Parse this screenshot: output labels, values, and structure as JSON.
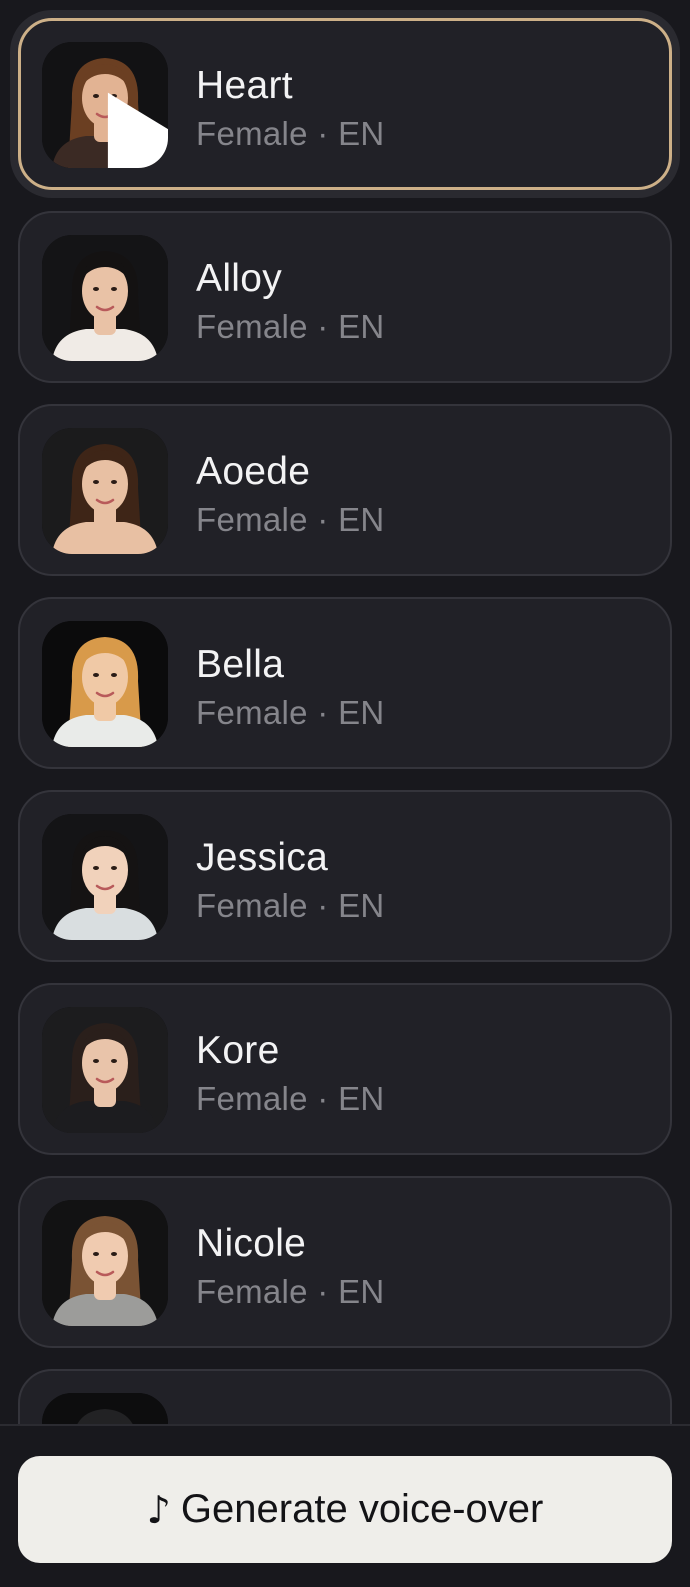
{
  "voices": [
    {
      "name": "Heart",
      "meta": "Female · EN",
      "selected": true,
      "hair": "#6b3f22",
      "skin": "#e2b393",
      "top": "#3b2a24",
      "bg": "#121214"
    },
    {
      "name": "Alloy",
      "meta": "Female · EN",
      "selected": false,
      "hair": "#141212",
      "skin": "#e9c2a6",
      "top": "#f0ebe6",
      "bg": "#141416"
    },
    {
      "name": "Aoede",
      "meta": "Female · EN",
      "selected": false,
      "hair": "#3e2517",
      "skin": "#e8c0a3",
      "top": "#e8c0a3",
      "bg": "#1b1b1c"
    },
    {
      "name": "Bella",
      "meta": "Female · EN",
      "selected": false,
      "hair": "#d89a4a",
      "skin": "#f0c9a6",
      "top": "#e9ebe9",
      "bg": "#0b0b0c"
    },
    {
      "name": "Jessica",
      "meta": "Female · EN",
      "selected": false,
      "hair": "#151313",
      "skin": "#f1d2bb",
      "top": "#d9dee0",
      "bg": "#141416"
    },
    {
      "name": "Kore",
      "meta": "Female · EN",
      "selected": false,
      "hair": "#2a1f1b",
      "skin": "#e9c4aa",
      "top": "#1c1c1f",
      "bg": "#1c1c1e"
    },
    {
      "name": "Nicole",
      "meta": "Female · EN",
      "selected": false,
      "hair": "#7a5334",
      "skin": "#f0cbb0",
      "top": "#9c9c9a",
      "bg": "#121213"
    },
    {
      "name": "",
      "meta": "",
      "selected": false,
      "hair": "#222224",
      "skin": "#2a2a2c",
      "top": "#1a1a1c",
      "bg": "#0d0d0e"
    }
  ],
  "play_icon": "play-icon",
  "button": {
    "icon": "♪",
    "label": "Generate voice-over"
  },
  "colors": {
    "accent": "#cdb088",
    "background": "#18181d",
    "card": "#212127",
    "button": "#efeeea"
  }
}
